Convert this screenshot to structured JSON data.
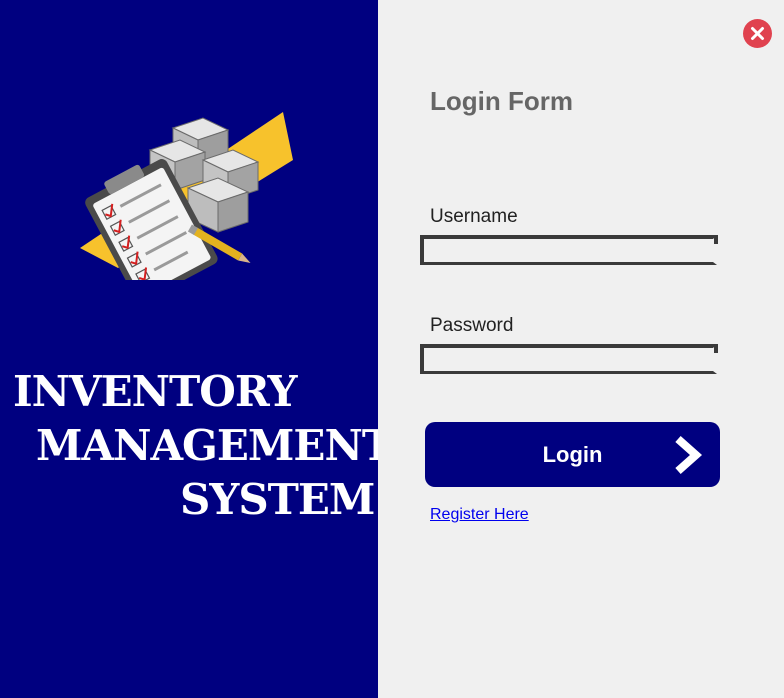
{
  "branding": {
    "logo_icon": "inventory-clipboard-boxes-icon",
    "title_line_1": "INVENTORY",
    "title_line_2": "MANAGEMENT",
    "title_line_3": "SYSTEM"
  },
  "form": {
    "title": "Login Form",
    "username_label": "Username",
    "username_value": "",
    "password_label": "Password",
    "password_value": "",
    "login_label": "Login",
    "login_icon": "chevron-right-icon",
    "register_link": "Register Here"
  },
  "window": {
    "close_icon": "close-icon"
  },
  "colors": {
    "brand_navy": "#000080",
    "panel_background": "#f0f0f0",
    "close_red": "#e0424f",
    "logo_yellow": "#f7c22c",
    "link_blue": "#0000ee"
  }
}
